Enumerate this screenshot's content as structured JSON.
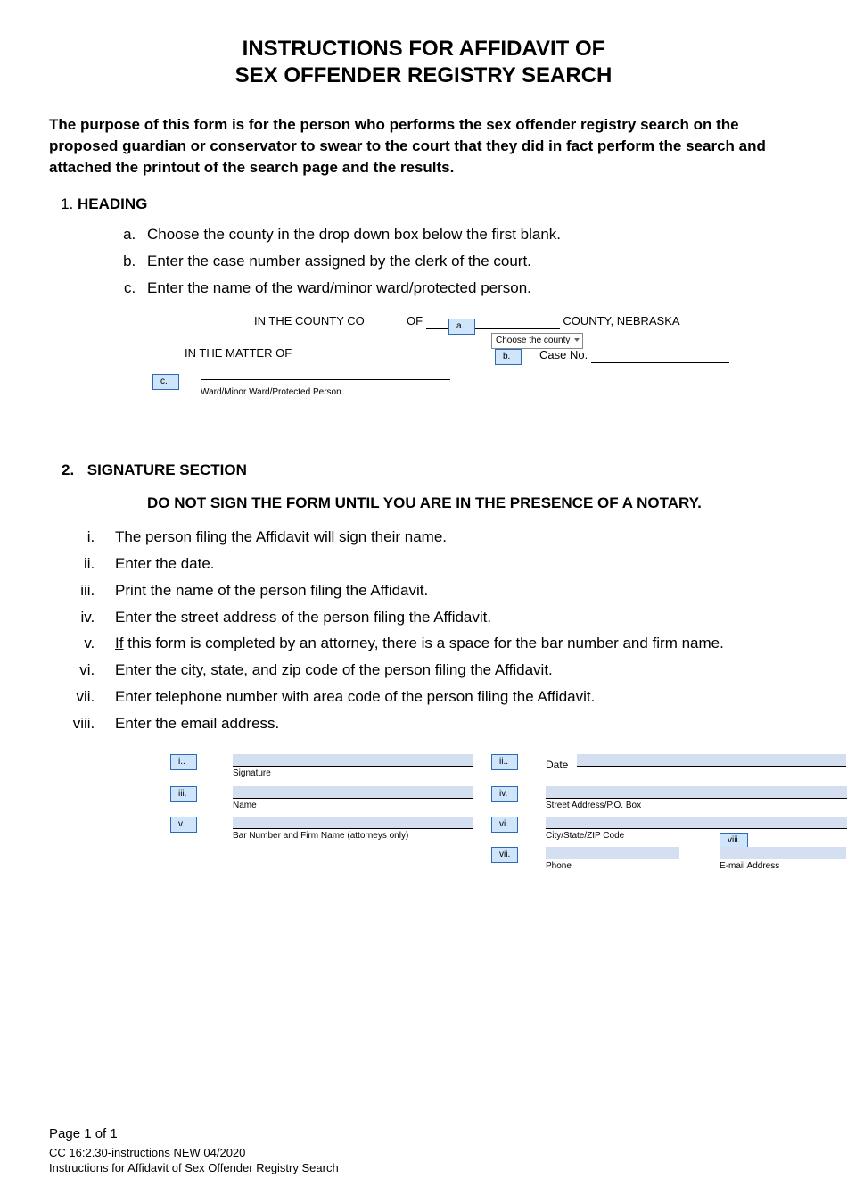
{
  "title_line1": "INSTRUCTIONS FOR AFFIDAVIT OF",
  "title_line2": "SEX OFFENDER REGISTRY SEARCH",
  "purpose": "The purpose of this form is for the person who performs the sex offender registry search on the proposed guardian or conservator to swear to the court that they did in fact perform the search and attached the printout of the search page and the results.",
  "section1": {
    "heading": "HEADING",
    "items": {
      "a": "Choose the county in the drop down box below the first blank.",
      "b": "Enter the case number assigned by the clerk of the court.",
      "c": "Enter the name of the ward/minor ward/protected person."
    }
  },
  "illus1": {
    "line1_pre": "IN THE  COUNTY  CO",
    "line1_of": "OF",
    "line1_post": "COUNTY, NEBRASKA",
    "dropdown": "Choose the county",
    "line2": "IN THE MATTER OF",
    "case_no_label": "Case No.",
    "ward_label": "Ward/Minor Ward/Protected Person",
    "tags": {
      "a": "a.",
      "b": "b.",
      "c": "c."
    }
  },
  "section2": {
    "num": "2.",
    "heading": "SIGNATURE SECTION",
    "warn": "DO NOT SIGN THE FORM UNTIL YOU ARE IN THE PRESENCE OF A NOTARY.",
    "items": {
      "i": "The person filing the Affidavit will sign their name.",
      "ii": "Enter the date.",
      "iii": "Print the name of the person filing the Affidavit.",
      "iv": "Enter the street address of the person filing the Affidavit.",
      "v_pre": "If",
      "v_post": " this form is completed by an attorney, there is a space for the bar number and firm name.",
      "vi": "Enter the city, state, and zip code of the person filing the Affidavit.",
      "vii": "Enter telephone number with area code of the person filing the Affidavit.",
      "viii": "Enter the email address."
    }
  },
  "illus2": {
    "tags": {
      "i": "i..",
      "ii": "ii..",
      "iii": "iii.",
      "iv": "iv.",
      "v": "v.",
      "vi": "vi.",
      "vii": "vii.",
      "viii": "viii."
    },
    "labels": {
      "signature": "Signature",
      "date": "Date",
      "name": "Name",
      "street": "Street Address/P.O. Box",
      "bar": "Bar Number and Firm Name (attorneys only)",
      "csz": "City/State/ZIP Code",
      "phone": "Phone",
      "email": "E-mail Address"
    }
  },
  "footer": {
    "page": "Page 1 of 1",
    "formno": "CC 16:2.30-instructions NEW 04/2020",
    "title": "Instructions for Affidavit of Sex Offender Registry Search"
  }
}
